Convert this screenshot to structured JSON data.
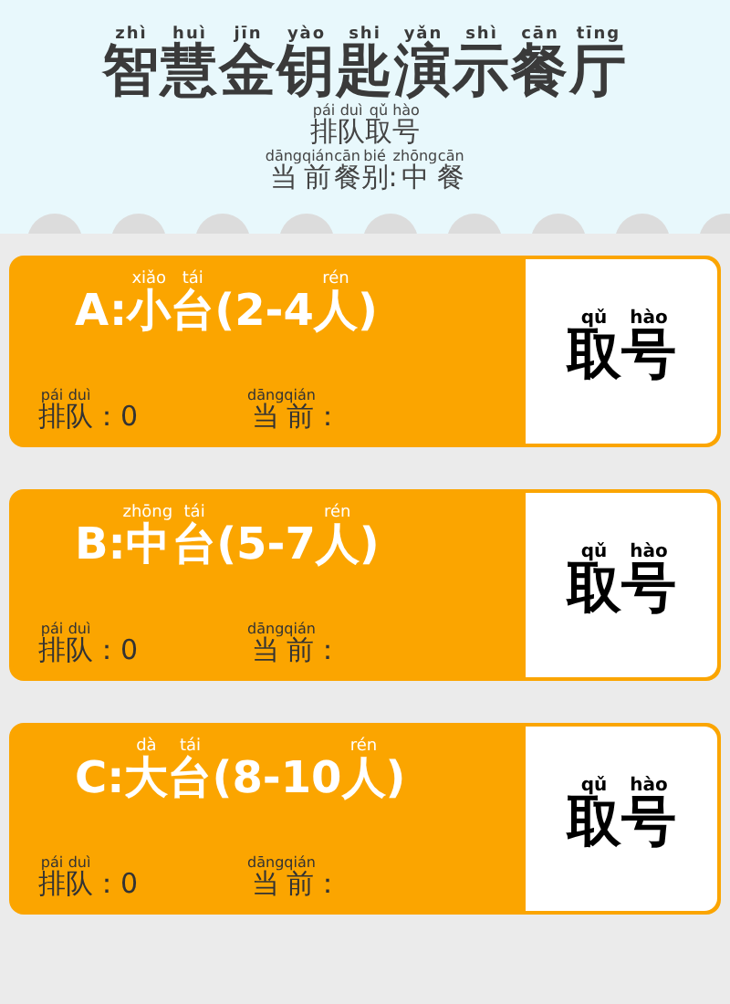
{
  "header": {
    "title": [
      {
        "t": "智",
        "py": "zhì"
      },
      {
        "t": "慧",
        "py": "huì"
      },
      {
        "t": "金",
        "py": "jīn"
      },
      {
        "t": "钥",
        "py": "yào"
      },
      {
        "t": "匙",
        "py": "shi"
      },
      {
        "t": "演",
        "py": "yǎn"
      },
      {
        "t": "示",
        "py": "shì"
      },
      {
        "t": "餐",
        "py": "cān"
      },
      {
        "t": "厅",
        "py": "tīng"
      }
    ],
    "subtitle": [
      {
        "t": "排",
        "py": "pái"
      },
      {
        "t": "队",
        "py": "duì"
      },
      {
        "t": "取",
        "py": "qǔ"
      },
      {
        "t": "号",
        "py": "hào"
      }
    ],
    "meal": [
      {
        "t": "当",
        "py": "dāng"
      },
      {
        "t": "前",
        "py": "qián"
      },
      {
        "t": "餐",
        "py": "cān"
      },
      {
        "t": "别",
        "py": "bié"
      },
      {
        "t": ":"
      },
      {
        "t": "中",
        "py": "zhōng"
      },
      {
        "t": "餐",
        "py": "cān"
      }
    ]
  },
  "tables": [
    {
      "name": [
        {
          "t": "A:"
        },
        {
          "t": "小",
          "py": "xiǎo"
        },
        {
          "t": "台",
          "py": "tái"
        },
        {
          "t": "(2-4"
        },
        {
          "t": "人",
          "py": "rén"
        },
        {
          "t": ")"
        }
      ],
      "queue": [
        {
          "t": "排",
          "py": "pái"
        },
        {
          "t": "队",
          "py": "duì"
        },
        {
          "t": "：0"
        }
      ],
      "current": [
        {
          "t": "当",
          "py": "dāng"
        },
        {
          "t": "前",
          "py": "qián"
        },
        {
          "t": "："
        }
      ],
      "button": [
        {
          "t": "取",
          "py": "qǔ"
        },
        {
          "t": "号",
          "py": "hào"
        }
      ]
    },
    {
      "name": [
        {
          "t": "B:"
        },
        {
          "t": "中",
          "py": "zhōng"
        },
        {
          "t": "台",
          "py": "tái"
        },
        {
          "t": "(5-7"
        },
        {
          "t": "人",
          "py": "rén"
        },
        {
          "t": ")"
        }
      ],
      "queue": [
        {
          "t": "排",
          "py": "pái"
        },
        {
          "t": "队",
          "py": "duì"
        },
        {
          "t": "：0"
        }
      ],
      "current": [
        {
          "t": "当",
          "py": "dāng"
        },
        {
          "t": "前",
          "py": "qián"
        },
        {
          "t": "："
        }
      ],
      "button": [
        {
          "t": "取",
          "py": "qǔ"
        },
        {
          "t": "号",
          "py": "hào"
        }
      ]
    },
    {
      "name": [
        {
          "t": "C:"
        },
        {
          "t": "大",
          "py": "dà"
        },
        {
          "t": "台",
          "py": "tái"
        },
        {
          "t": "(8-10"
        },
        {
          "t": "人",
          "py": "rén"
        },
        {
          "t": ")"
        }
      ],
      "queue": [
        {
          "t": "排",
          "py": "pái"
        },
        {
          "t": "队",
          "py": "duì"
        },
        {
          "t": "：0"
        }
      ],
      "current": [
        {
          "t": "当",
          "py": "dāng"
        },
        {
          "t": "前",
          "py": "qián"
        },
        {
          "t": "："
        }
      ],
      "button": [
        {
          "t": "取",
          "py": "qǔ"
        },
        {
          "t": "号",
          "py": "hào"
        }
      ]
    }
  ]
}
